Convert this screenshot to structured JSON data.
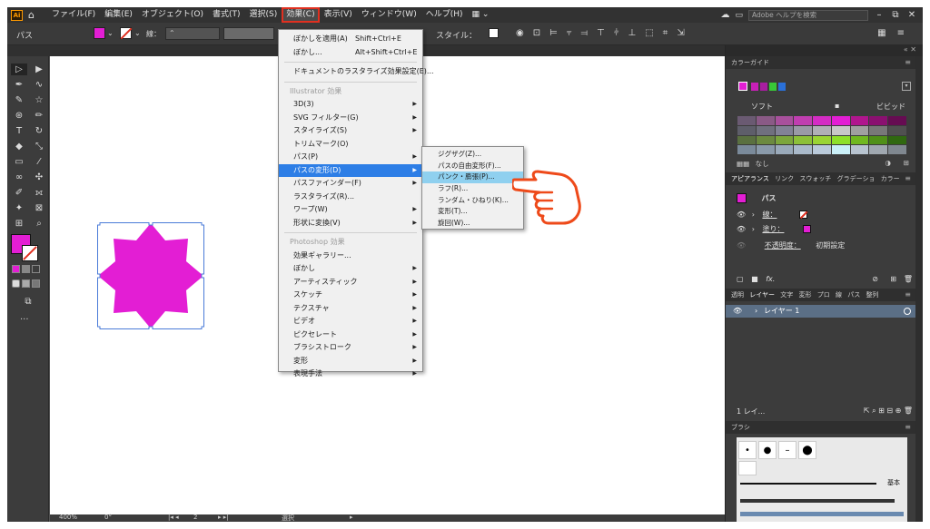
{
  "app": {
    "logo": "Ai",
    "home_icon": "home-icon"
  },
  "menubar": {
    "items": [
      "ファイル(F)",
      "編集(E)",
      "オブジェクト(O)",
      "書式(T)",
      "選択(S)",
      "効果(C)",
      "表示(V)",
      "ウィンドウ(W)",
      "ヘルプ(H)"
    ],
    "active_index": 5,
    "search_placeholder": "Adobe ヘルプを検索"
  },
  "controlbar": {
    "selection_label": "パス",
    "stroke_label": "線：",
    "style_label": "スタイル：",
    "fill_color": "#e31ed4"
  },
  "effect_menu": {
    "apply_last": {
      "label": "ぼかしを適用(A)",
      "shortcut": "Shift+Ctrl+E"
    },
    "last_effect": {
      "label": "ぼかし...",
      "shortcut": "Alt+Shift+Ctrl+E"
    },
    "raster_settings": "ドキュメントのラスタライズ効果設定(E)...",
    "illustrator_section": "Illustrator 効果",
    "illustrator_items": [
      {
        "label": "3D(3)",
        "submenu": true
      },
      {
        "label": "SVG フィルター(G)",
        "submenu": true
      },
      {
        "label": "スタイライズ(S)",
        "submenu": true
      },
      {
        "label": "トリムマーク(O)",
        "submenu": false
      },
      {
        "label": "パス(P)",
        "submenu": true
      },
      {
        "label": "パスの変形(D)",
        "submenu": true,
        "highlighted": true
      },
      {
        "label": "パスファインダー(F)",
        "submenu": true
      },
      {
        "label": "ラスタライズ(R)...",
        "submenu": false
      },
      {
        "label": "ワープ(W)",
        "submenu": true
      },
      {
        "label": "形状に変換(V)",
        "submenu": true
      }
    ],
    "photoshop_section": "Photoshop 効果",
    "photoshop_items": [
      {
        "label": "効果ギャラリー...",
        "submenu": false
      },
      {
        "label": "ぼかし",
        "submenu": true
      },
      {
        "label": "アーティスティック",
        "submenu": true
      },
      {
        "label": "スケッチ",
        "submenu": true
      },
      {
        "label": "テクスチャ",
        "submenu": true
      },
      {
        "label": "ビデオ",
        "submenu": true
      },
      {
        "label": "ピクセレート",
        "submenu": true
      },
      {
        "label": "ブラシストローク",
        "submenu": true
      },
      {
        "label": "変形",
        "submenu": true
      },
      {
        "label": "表現手法",
        "submenu": true
      }
    ]
  },
  "distort_submenu": {
    "items": [
      {
        "label": "ジグザグ(Z)..."
      },
      {
        "label": "パスの自由変形(F)..."
      },
      {
        "label": "パンク・膨張(P)...",
        "highlighted": true
      },
      {
        "label": "ラフ(R)..."
      },
      {
        "label": "ランダム・ひねり(K)..."
      },
      {
        "label": "変形(T)..."
      },
      {
        "label": "旋回(W)..."
      }
    ]
  },
  "canvas": {
    "shape": "8-point star",
    "shape_color": "#e31ed4"
  },
  "statusbar": {
    "zoom": "400%",
    "angle": "0°",
    "artboard": "2",
    "tool": "選択"
  },
  "color_guide": {
    "title": "カラーガイド",
    "base_color": "#e31ed4",
    "harmony": [
      "#c820b8",
      "#a81ea0",
      "#38c838",
      "#2a70d8"
    ],
    "soft_label": "ソフト",
    "vivid_label": "ビビッド",
    "grid": [
      [
        "#6a5a72",
        "#8a5a86",
        "#a8509c",
        "#c03eb0",
        "#d42cc4",
        "#e31ed4",
        "#b0168e",
        "#8a1070",
        "#660c52"
      ],
      [
        "#5e5e6a",
        "#70707e",
        "#828296",
        "#9a9aa6",
        "#b0b0b6",
        "#c8c8c8",
        "#a0a0a0",
        "#787878",
        "#505050"
      ],
      [
        "#5a7040",
        "#6c8a40",
        "#7ca63c",
        "#8cc038",
        "#9ad434",
        "#8ee02a",
        "#70b820",
        "#509018",
        "#306810"
      ],
      [
        "#7a8a9a",
        "#8a9aaa",
        "#9aaaba",
        "#aabaca",
        "#bacada",
        "#caf0f8",
        "#b8c4d0",
        "#a0a8b0",
        "#808890"
      ]
    ],
    "none_label": "なし"
  },
  "appearance": {
    "tabs": [
      "アピアランス",
      "リンク",
      "スウォッチ",
      "グラデーショ",
      "カラー"
    ],
    "object": "パス",
    "stroke_label": "線：",
    "fill_label": "塗り：",
    "opacity_label": "不透明度：",
    "opacity_value": "初期設定"
  },
  "layers": {
    "tabs": [
      "透明",
      "レイヤー",
      "文字",
      "変形",
      "プロ",
      "線",
      "パス",
      "整列"
    ],
    "layer_name": "レイヤー 1",
    "count_label": "1 レイ..."
  },
  "brushes": {
    "title": "ブラシ",
    "basic_label": "基本"
  }
}
